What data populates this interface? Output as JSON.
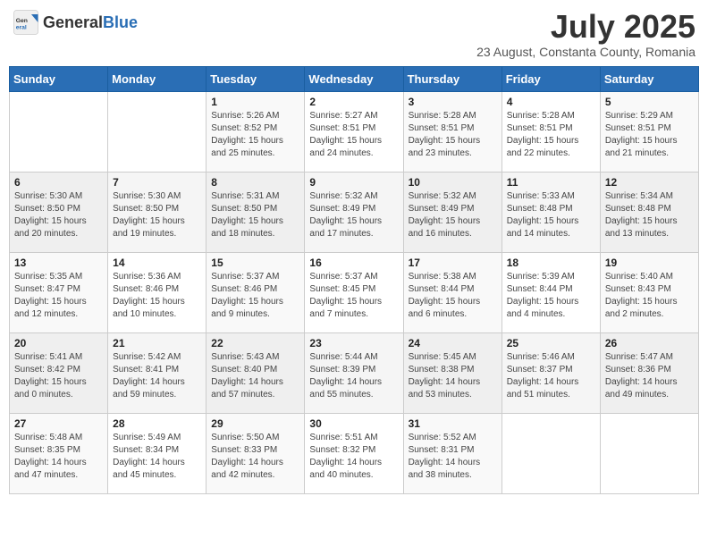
{
  "header": {
    "logo_general": "General",
    "logo_blue": "Blue",
    "month_title": "July 2025",
    "subtitle": "23 August, Constanta County, Romania"
  },
  "days_of_week": [
    "Sunday",
    "Monday",
    "Tuesday",
    "Wednesday",
    "Thursday",
    "Friday",
    "Saturday"
  ],
  "weeks": [
    [
      {
        "day": "",
        "info": ""
      },
      {
        "day": "",
        "info": ""
      },
      {
        "day": "1",
        "info": "Sunrise: 5:26 AM\nSunset: 8:52 PM\nDaylight: 15 hours and 25 minutes."
      },
      {
        "day": "2",
        "info": "Sunrise: 5:27 AM\nSunset: 8:51 PM\nDaylight: 15 hours and 24 minutes."
      },
      {
        "day": "3",
        "info": "Sunrise: 5:28 AM\nSunset: 8:51 PM\nDaylight: 15 hours and 23 minutes."
      },
      {
        "day": "4",
        "info": "Sunrise: 5:28 AM\nSunset: 8:51 PM\nDaylight: 15 hours and 22 minutes."
      },
      {
        "day": "5",
        "info": "Sunrise: 5:29 AM\nSunset: 8:51 PM\nDaylight: 15 hours and 21 minutes."
      }
    ],
    [
      {
        "day": "6",
        "info": "Sunrise: 5:30 AM\nSunset: 8:50 PM\nDaylight: 15 hours and 20 minutes."
      },
      {
        "day": "7",
        "info": "Sunrise: 5:30 AM\nSunset: 8:50 PM\nDaylight: 15 hours and 19 minutes."
      },
      {
        "day": "8",
        "info": "Sunrise: 5:31 AM\nSunset: 8:50 PM\nDaylight: 15 hours and 18 minutes."
      },
      {
        "day": "9",
        "info": "Sunrise: 5:32 AM\nSunset: 8:49 PM\nDaylight: 15 hours and 17 minutes."
      },
      {
        "day": "10",
        "info": "Sunrise: 5:32 AM\nSunset: 8:49 PM\nDaylight: 15 hours and 16 minutes."
      },
      {
        "day": "11",
        "info": "Sunrise: 5:33 AM\nSunset: 8:48 PM\nDaylight: 15 hours and 14 minutes."
      },
      {
        "day": "12",
        "info": "Sunrise: 5:34 AM\nSunset: 8:48 PM\nDaylight: 15 hours and 13 minutes."
      }
    ],
    [
      {
        "day": "13",
        "info": "Sunrise: 5:35 AM\nSunset: 8:47 PM\nDaylight: 15 hours and 12 minutes."
      },
      {
        "day": "14",
        "info": "Sunrise: 5:36 AM\nSunset: 8:46 PM\nDaylight: 15 hours and 10 minutes."
      },
      {
        "day": "15",
        "info": "Sunrise: 5:37 AM\nSunset: 8:46 PM\nDaylight: 15 hours and 9 minutes."
      },
      {
        "day": "16",
        "info": "Sunrise: 5:37 AM\nSunset: 8:45 PM\nDaylight: 15 hours and 7 minutes."
      },
      {
        "day": "17",
        "info": "Sunrise: 5:38 AM\nSunset: 8:44 PM\nDaylight: 15 hours and 6 minutes."
      },
      {
        "day": "18",
        "info": "Sunrise: 5:39 AM\nSunset: 8:44 PM\nDaylight: 15 hours and 4 minutes."
      },
      {
        "day": "19",
        "info": "Sunrise: 5:40 AM\nSunset: 8:43 PM\nDaylight: 15 hours and 2 minutes."
      }
    ],
    [
      {
        "day": "20",
        "info": "Sunrise: 5:41 AM\nSunset: 8:42 PM\nDaylight: 15 hours and 0 minutes."
      },
      {
        "day": "21",
        "info": "Sunrise: 5:42 AM\nSunset: 8:41 PM\nDaylight: 14 hours and 59 minutes."
      },
      {
        "day": "22",
        "info": "Sunrise: 5:43 AM\nSunset: 8:40 PM\nDaylight: 14 hours and 57 minutes."
      },
      {
        "day": "23",
        "info": "Sunrise: 5:44 AM\nSunset: 8:39 PM\nDaylight: 14 hours and 55 minutes."
      },
      {
        "day": "24",
        "info": "Sunrise: 5:45 AM\nSunset: 8:38 PM\nDaylight: 14 hours and 53 minutes."
      },
      {
        "day": "25",
        "info": "Sunrise: 5:46 AM\nSunset: 8:37 PM\nDaylight: 14 hours and 51 minutes."
      },
      {
        "day": "26",
        "info": "Sunrise: 5:47 AM\nSunset: 8:36 PM\nDaylight: 14 hours and 49 minutes."
      }
    ],
    [
      {
        "day": "27",
        "info": "Sunrise: 5:48 AM\nSunset: 8:35 PM\nDaylight: 14 hours and 47 minutes."
      },
      {
        "day": "28",
        "info": "Sunrise: 5:49 AM\nSunset: 8:34 PM\nDaylight: 14 hours and 45 minutes."
      },
      {
        "day": "29",
        "info": "Sunrise: 5:50 AM\nSunset: 8:33 PM\nDaylight: 14 hours and 42 minutes."
      },
      {
        "day": "30",
        "info": "Sunrise: 5:51 AM\nSunset: 8:32 PM\nDaylight: 14 hours and 40 minutes."
      },
      {
        "day": "31",
        "info": "Sunrise: 5:52 AM\nSunset: 8:31 PM\nDaylight: 14 hours and 38 minutes."
      },
      {
        "day": "",
        "info": ""
      },
      {
        "day": "",
        "info": ""
      }
    ]
  ]
}
